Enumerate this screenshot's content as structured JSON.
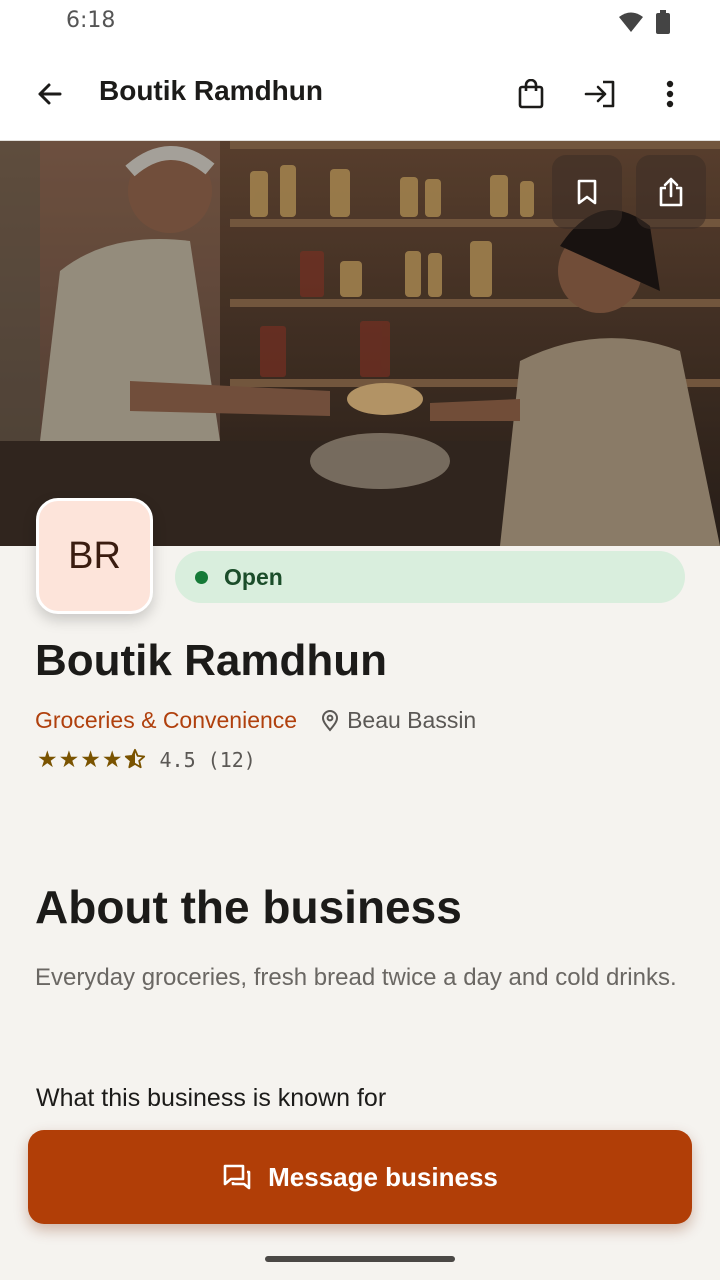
{
  "status_bar": {
    "time": "6:18",
    "icons": [
      "wifi-icon",
      "battery-icon"
    ]
  },
  "app_bar": {
    "title": "Boutik Ramdhun",
    "icons": [
      "back-arrow-icon",
      "shopping-bag-icon",
      "login-icon",
      "more-vert-icon"
    ]
  },
  "hero": {
    "image_subject": "shopkeeper handing bread to a customer in a small grocery shop",
    "actions": [
      "bookmark-icon",
      "share-icon"
    ]
  },
  "business": {
    "initials": "BR",
    "status": "Open",
    "name": "Boutik Ramdhun",
    "category": "Groceries & Convenience",
    "location": "Beau Bassin",
    "rating": 4.5,
    "rating_text": "4.5 (12)"
  },
  "about": {
    "title": "About the business",
    "description": "Everyday groceries, fresh bread twice a day and cold drinks.",
    "known_for_label": "What this business is known for"
  },
  "cta": {
    "label": "Message business"
  },
  "colors": {
    "accent": "#b13e07",
    "open_chip": "#d9eedd",
    "open_dot": "#157a37",
    "avatar_bg": "#fde4da",
    "star": "#7a5300"
  }
}
